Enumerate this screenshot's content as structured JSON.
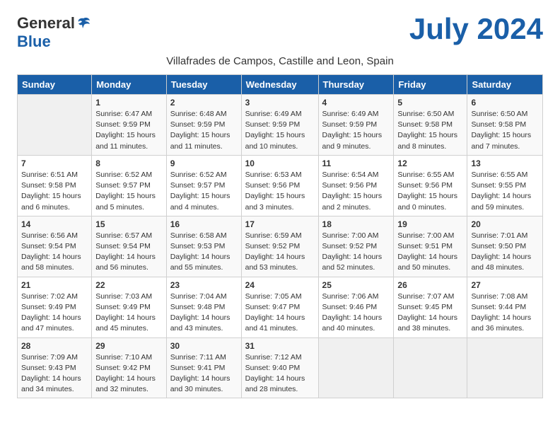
{
  "header": {
    "logo_general": "General",
    "logo_blue": "Blue",
    "month_year": "July 2024",
    "subtitle": "Villafrades de Campos, Castille and Leon, Spain"
  },
  "days_of_week": [
    "Sunday",
    "Monday",
    "Tuesday",
    "Wednesday",
    "Thursday",
    "Friday",
    "Saturday"
  ],
  "weeks": [
    [
      {
        "day": "",
        "detail": ""
      },
      {
        "day": "1",
        "detail": "Sunrise: 6:47 AM\nSunset: 9:59 PM\nDaylight: 15 hours\nand 11 minutes."
      },
      {
        "day": "2",
        "detail": "Sunrise: 6:48 AM\nSunset: 9:59 PM\nDaylight: 15 hours\nand 11 minutes."
      },
      {
        "day": "3",
        "detail": "Sunrise: 6:49 AM\nSunset: 9:59 PM\nDaylight: 15 hours\nand 10 minutes."
      },
      {
        "day": "4",
        "detail": "Sunrise: 6:49 AM\nSunset: 9:59 PM\nDaylight: 15 hours\nand 9 minutes."
      },
      {
        "day": "5",
        "detail": "Sunrise: 6:50 AM\nSunset: 9:58 PM\nDaylight: 15 hours\nand 8 minutes."
      },
      {
        "day": "6",
        "detail": "Sunrise: 6:50 AM\nSunset: 9:58 PM\nDaylight: 15 hours\nand 7 minutes."
      }
    ],
    [
      {
        "day": "7",
        "detail": "Sunrise: 6:51 AM\nSunset: 9:58 PM\nDaylight: 15 hours\nand 6 minutes."
      },
      {
        "day": "8",
        "detail": "Sunrise: 6:52 AM\nSunset: 9:57 PM\nDaylight: 15 hours\nand 5 minutes."
      },
      {
        "day": "9",
        "detail": "Sunrise: 6:52 AM\nSunset: 9:57 PM\nDaylight: 15 hours\nand 4 minutes."
      },
      {
        "day": "10",
        "detail": "Sunrise: 6:53 AM\nSunset: 9:56 PM\nDaylight: 15 hours\nand 3 minutes."
      },
      {
        "day": "11",
        "detail": "Sunrise: 6:54 AM\nSunset: 9:56 PM\nDaylight: 15 hours\nand 2 minutes."
      },
      {
        "day": "12",
        "detail": "Sunrise: 6:55 AM\nSunset: 9:56 PM\nDaylight: 15 hours\nand 0 minutes."
      },
      {
        "day": "13",
        "detail": "Sunrise: 6:55 AM\nSunset: 9:55 PM\nDaylight: 14 hours\nand 59 minutes."
      }
    ],
    [
      {
        "day": "14",
        "detail": "Sunrise: 6:56 AM\nSunset: 9:54 PM\nDaylight: 14 hours\nand 58 minutes."
      },
      {
        "day": "15",
        "detail": "Sunrise: 6:57 AM\nSunset: 9:54 PM\nDaylight: 14 hours\nand 56 minutes."
      },
      {
        "day": "16",
        "detail": "Sunrise: 6:58 AM\nSunset: 9:53 PM\nDaylight: 14 hours\nand 55 minutes."
      },
      {
        "day": "17",
        "detail": "Sunrise: 6:59 AM\nSunset: 9:52 PM\nDaylight: 14 hours\nand 53 minutes."
      },
      {
        "day": "18",
        "detail": "Sunrise: 7:00 AM\nSunset: 9:52 PM\nDaylight: 14 hours\nand 52 minutes."
      },
      {
        "day": "19",
        "detail": "Sunrise: 7:00 AM\nSunset: 9:51 PM\nDaylight: 14 hours\nand 50 minutes."
      },
      {
        "day": "20",
        "detail": "Sunrise: 7:01 AM\nSunset: 9:50 PM\nDaylight: 14 hours\nand 48 minutes."
      }
    ],
    [
      {
        "day": "21",
        "detail": "Sunrise: 7:02 AM\nSunset: 9:49 PM\nDaylight: 14 hours\nand 47 minutes."
      },
      {
        "day": "22",
        "detail": "Sunrise: 7:03 AM\nSunset: 9:49 PM\nDaylight: 14 hours\nand 45 minutes."
      },
      {
        "day": "23",
        "detail": "Sunrise: 7:04 AM\nSunset: 9:48 PM\nDaylight: 14 hours\nand 43 minutes."
      },
      {
        "day": "24",
        "detail": "Sunrise: 7:05 AM\nSunset: 9:47 PM\nDaylight: 14 hours\nand 41 minutes."
      },
      {
        "day": "25",
        "detail": "Sunrise: 7:06 AM\nSunset: 9:46 PM\nDaylight: 14 hours\nand 40 minutes."
      },
      {
        "day": "26",
        "detail": "Sunrise: 7:07 AM\nSunset: 9:45 PM\nDaylight: 14 hours\nand 38 minutes."
      },
      {
        "day": "27",
        "detail": "Sunrise: 7:08 AM\nSunset: 9:44 PM\nDaylight: 14 hours\nand 36 minutes."
      }
    ],
    [
      {
        "day": "28",
        "detail": "Sunrise: 7:09 AM\nSunset: 9:43 PM\nDaylight: 14 hours\nand 34 minutes."
      },
      {
        "day": "29",
        "detail": "Sunrise: 7:10 AM\nSunset: 9:42 PM\nDaylight: 14 hours\nand 32 minutes."
      },
      {
        "day": "30",
        "detail": "Sunrise: 7:11 AM\nSunset: 9:41 PM\nDaylight: 14 hours\nand 30 minutes."
      },
      {
        "day": "31",
        "detail": "Sunrise: 7:12 AM\nSunset: 9:40 PM\nDaylight: 14 hours\nand 28 minutes."
      },
      {
        "day": "",
        "detail": ""
      },
      {
        "day": "",
        "detail": ""
      },
      {
        "day": "",
        "detail": ""
      }
    ]
  ]
}
